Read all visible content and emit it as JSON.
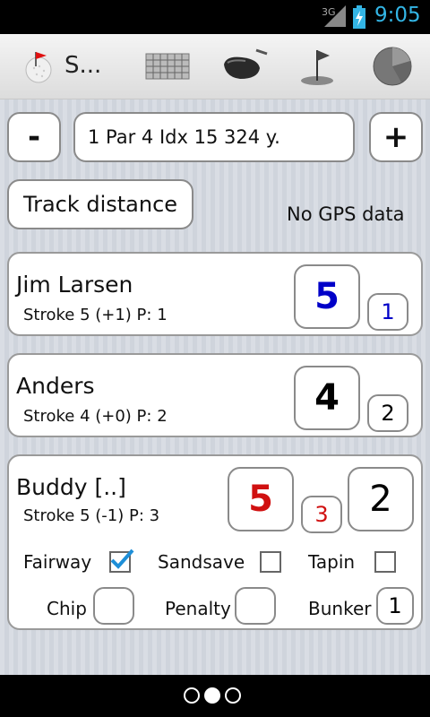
{
  "status_bar": {
    "network": "3G",
    "time": "9:05",
    "clock_color": "#33b5e5"
  },
  "action_bar": {
    "title": "S...",
    "icons": [
      "golf-ball-flag-icon",
      "scorecard-icon",
      "driver-club-icon",
      "hole-flag-icon",
      "stats-pie-icon"
    ]
  },
  "hole": {
    "prev_label": "-",
    "next_label": "+",
    "description": "1 Par 4 Idx 15 324 y."
  },
  "gps": {
    "track_label": "Track distance",
    "status": "No GPS data"
  },
  "players": [
    {
      "name": "Jim Larsen",
      "stats": "Stroke 5 (+1) P: 1",
      "score": "5",
      "putts": "1",
      "color": "#0000c8"
    },
    {
      "name": "Anders",
      "stats": "Stroke 4 (+0) P: 2",
      "score": "4",
      "putts": "2",
      "color": "#000000"
    },
    {
      "name": "Buddy [..]",
      "stats": "Stroke 5 (-1) P: 3",
      "score": "5",
      "putts": "3",
      "extra": "2",
      "color": "#d01010"
    }
  ],
  "options": {
    "fairway": {
      "label": "Fairway",
      "checked": true
    },
    "sandsave": {
      "label": "Sandsave",
      "checked": false
    },
    "tapin": {
      "label": "Tapin",
      "checked": false
    },
    "chip": {
      "label": "Chip",
      "value": ""
    },
    "penalty": {
      "label": "Penalty",
      "value": ""
    },
    "bunker": {
      "label": "Bunker",
      "value": "1"
    }
  },
  "pager": {
    "pages": 3,
    "active": 1
  }
}
